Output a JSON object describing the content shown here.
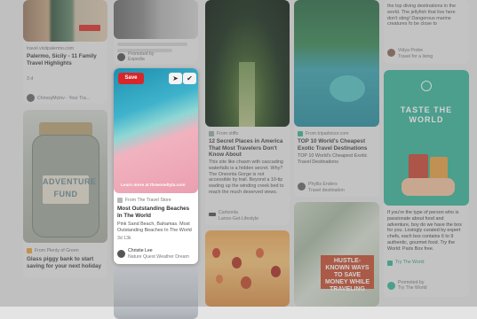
{
  "col1": {
    "pin1": {
      "site": "travel.visitpalermo.com",
      "title": "Palermo, Sicily - 11 Family Travel Highlights",
      "meta": "3 d",
      "user": "ChrissyMclnv - Your Tra..."
    },
    "pin2": {
      "site": "From Plenty of Green",
      "title": "Glass piggy bank to start saving for your next holiday",
      "meta": "3 d",
      "jar_text": "ADVENTURE FUND"
    }
  },
  "col2": {
    "promoted": "Promoted by",
    "promoted_by": "Expedia",
    "active": {
      "save_label": "Save",
      "link_text": "Learn more at thrwoneltyla.com",
      "site": "From The Travel Store",
      "title": "Most Outstanding Beaches In The World",
      "desc": "Pink Sand Beach, Bahamas. Most Outstanding Beaches In The World",
      "meta": "3d 13k",
      "user": "Christie Lee",
      "user_sub": "Nature Quest Weather Dream"
    }
  },
  "col3": {
    "pin1": {
      "site": "From stiffo",
      "title": "12 Secret Places in America That Most Travelers Don't Know About",
      "desc": "This site like chasm with cascading waterfalls is a hidden secret. Why? The Oneonta Gorge is not accessible by trail. Beyond a 10-tip wading up the winding creek bed to reach the much deserved views.",
      "user": "Carlsonla",
      "user_sub": "Lance-Get-Lifestyle"
    }
  },
  "col4": {
    "pin1": {
      "site": "From tripadvisor.com",
      "title": "TOP 10 World's Cheapest Exotic Travel Destinations",
      "desc": "TOP 10 World's Cheapest Exotic Travel Destinations",
      "user": "Phyllis Enders",
      "user_sub": "Travel destination"
    },
    "money_text": "HUSTLE-KNOWN WAYS TO SAVE MONEY WHILE TRAVELING"
  },
  "col5": {
    "pin1": {
      "desc": "the top diving destinations in the world. The jellyfish that live here don't sting! Dangerous marine creatures fo be close to",
      "user": "Vidya Probe",
      "user_sub": "Travel for a living"
    },
    "ad": {
      "title": "TASTE THE WORLD",
      "desc": "If you're the type of person who is passionate about food and adventure, boy do we have the box for you. Lovingly curated by expert chefs, each box contains 6 to 9 authentic, gourmet food. Try the World: Paris Box free.",
      "site": "Try The World",
      "promoted": "Promoted by",
      "promoted_by": "Try The World"
    }
  },
  "colors": {
    "save_red": "#d9262a",
    "teal_card": "#3db59a",
    "page_bg": "#e4e4e4"
  }
}
